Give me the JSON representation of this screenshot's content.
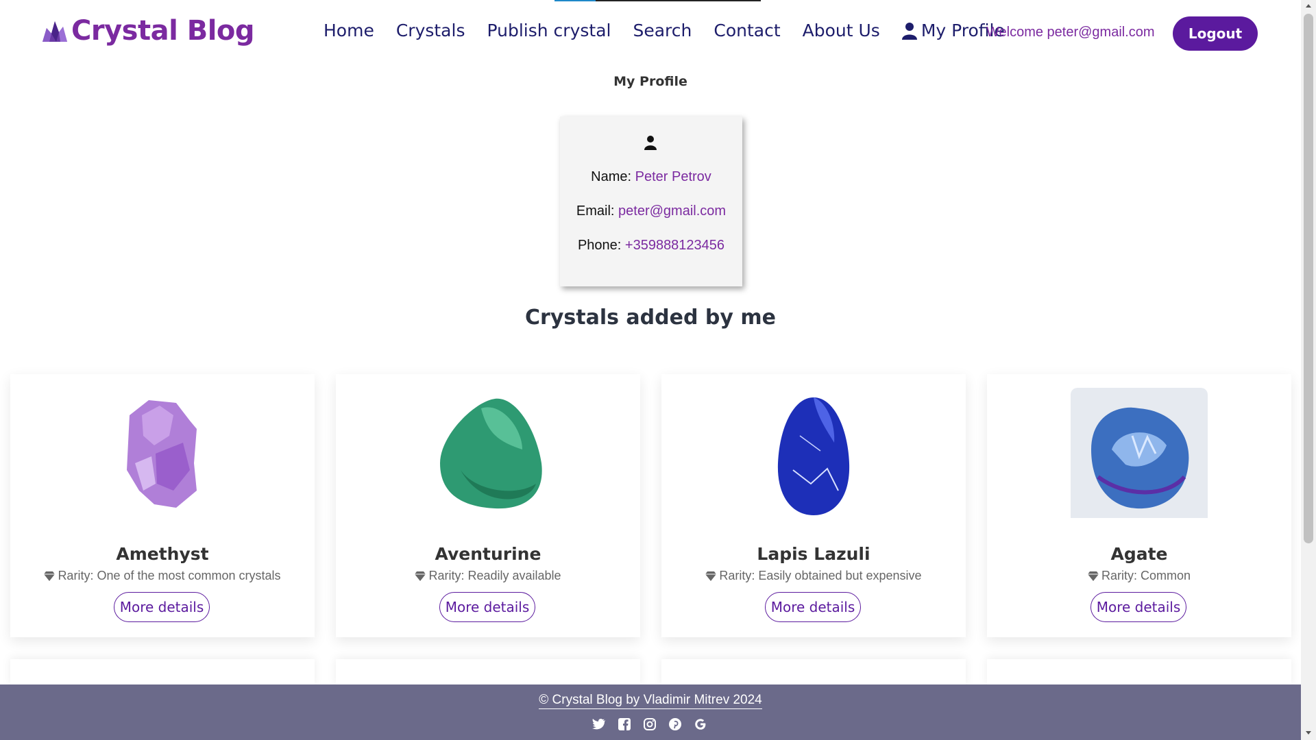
{
  "brand": {
    "name": "Crystal Blog",
    "accent": "#7b2aa0"
  },
  "nav": {
    "items": [
      "Home",
      "Crystals",
      "Publish crystal",
      "Search",
      "Contact",
      "About Us"
    ],
    "profile_label": "My Profile",
    "welcome": "Welcome peter@gmail.com",
    "logout_label": "Logout"
  },
  "page": {
    "title": "My Profile"
  },
  "profile": {
    "name_label": "Name:",
    "name": "Peter Petrov",
    "email_label": "Email:",
    "email": "peter@gmail.com",
    "phone_label": "Phone:",
    "phone": "+359888123456"
  },
  "section": {
    "title": "Crystals added by me"
  },
  "crystals": [
    {
      "name": "Amethyst",
      "rarity": "Rarity: One of the most common crystals",
      "more": "More details",
      "icon": "amethyst-image"
    },
    {
      "name": "Aventurine",
      "rarity": "Rarity: Readily available",
      "more": "More details",
      "icon": "aventurine-image"
    },
    {
      "name": "Lapis Lazuli",
      "rarity": "Rarity: Easily obtained but expensive",
      "more": "More details",
      "icon": "lapis-lazuli-image"
    },
    {
      "name": "Agate",
      "rarity": "Rarity: Common",
      "more": "More details",
      "icon": "agate-image"
    }
  ],
  "footer": {
    "text": "© Crystal Blog by Vladimir Mitrev 2024",
    "socials": [
      "twitter-icon",
      "facebook-icon",
      "instagram-icon",
      "pinterest-icon",
      "google-icon"
    ]
  }
}
